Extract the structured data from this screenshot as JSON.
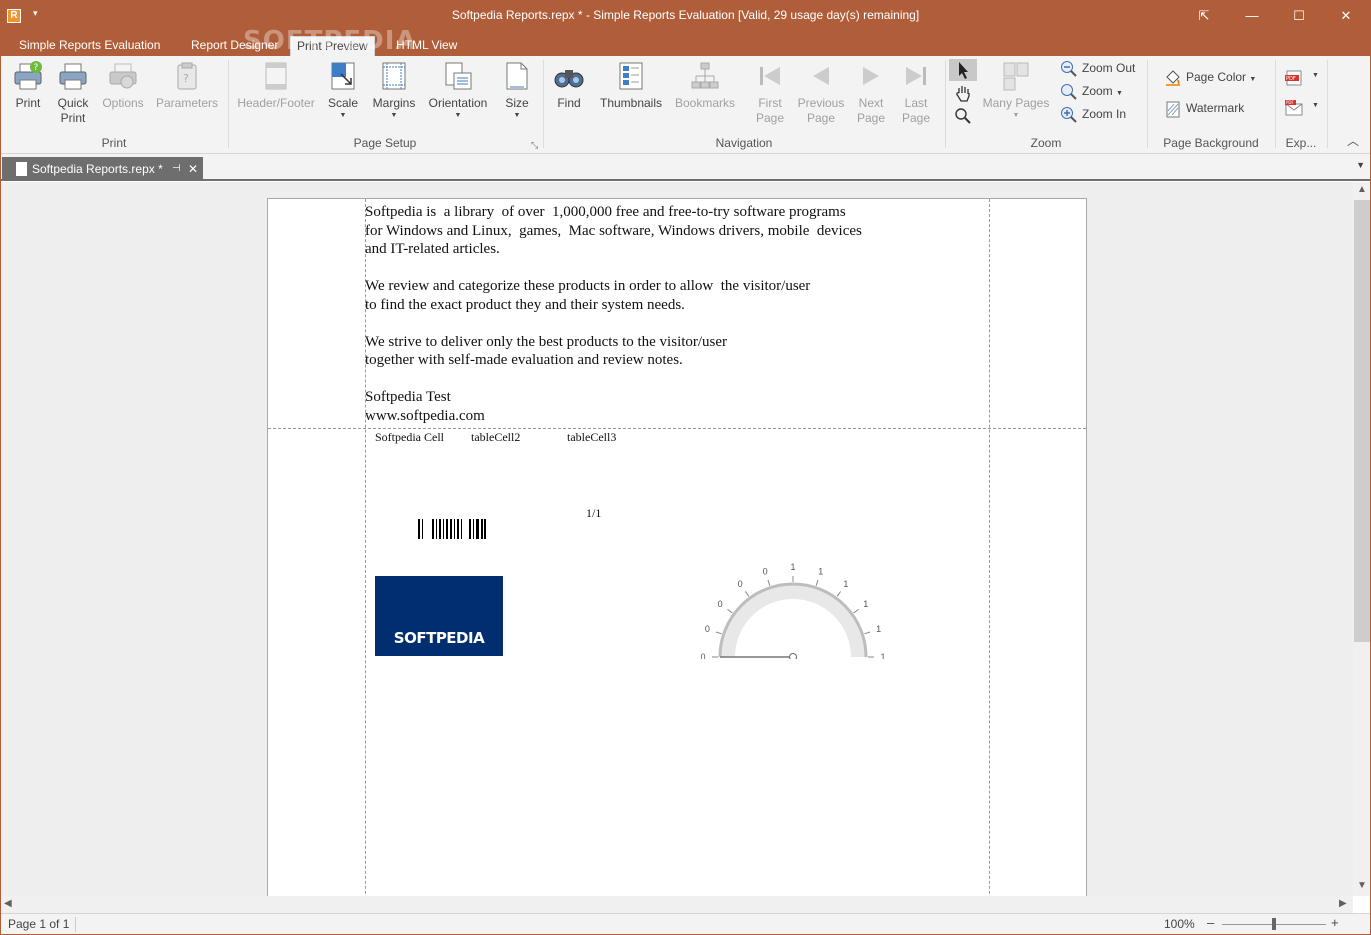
{
  "window": {
    "title": "Softpedia Reports.repx * - Simple Reports Evaluation [Valid,  29 usage day(s) remaining]",
    "app_icon_letter": "R",
    "qat_arrow": "▾",
    "minimize_glyph": "—",
    "restore_glyph": "☐",
    "close_glyph": "✕",
    "ribbon_display_glyph": "⇱"
  },
  "menu_tabs": [
    {
      "label": "Simple Reports Evaluation"
    },
    {
      "label": "Report Designer"
    },
    {
      "label": "Print Preview"
    },
    {
      "label": "HTML View"
    }
  ],
  "watermark_logo": "SOFTPEDIA",
  "ribbon": {
    "print_group": {
      "label": "Print",
      "print": "Print",
      "quick_print_1": "Quick",
      "quick_print_2": "Print",
      "options": "Options",
      "parameters": "Parameters"
    },
    "page_setup_group": {
      "label": "Page Setup",
      "header_footer": "Header/Footer",
      "scale": "Scale",
      "margins": "Margins",
      "orientation": "Orientation",
      "size": "Size",
      "dd_glyph": "▼",
      "launcher": "⤡"
    },
    "navigation_group": {
      "label": "Navigation",
      "find": "Find",
      "thumbnails": "Thumbnails",
      "bookmarks": "Bookmarks",
      "first_1": "First",
      "first_2": "Page",
      "prev_1": "Previous",
      "prev_2": "Page",
      "next_1": "Next",
      "next_2": "Page",
      "last_1": "Last",
      "last_2": "Page"
    },
    "zoom_group": {
      "label": "Zoom",
      "many_pages": "Many Pages",
      "zoom_out": "Zoom Out",
      "zoom": "Zoom",
      "zoom_in": "Zoom In"
    },
    "page_background_group": {
      "label": "Page Background",
      "page_color": "Page Color",
      "watermark": "Watermark"
    },
    "export_group": {
      "label": "Exp..."
    },
    "collapse_glyph": "︿"
  },
  "doc_tab": {
    "title": "Softpedia Reports.repx *",
    "pin_glyph": "⊣",
    "close_glyph": "✕",
    "dropdown_glyph": "▼"
  },
  "report": {
    "paragraph_text": "Softpedia is  a library  of over  1,000,000 free and free-to-try software programs\nfor Windows and Linux,  games,  Mac software, Windows drivers, mobile  devices\nand IT-related articles.\n\nWe review and categorize these products in order to allow  the visitor/user\nto find the exact product they and their system needs.\n\nWe strive to deliver only the best products to the visitor/user\ntogether with self-made evaluation and review notes.\n\nSoftpedia Test\nwww.softpedia.com",
    "cells": [
      "Softpedia Cell",
      "tableCell2",
      "tableCell3"
    ],
    "page_number": "1/1",
    "logo_text": "SOFTPEDIA",
    "gauge_labels": [
      "0",
      "0",
      "0",
      "0",
      "0",
      "1",
      "1",
      "1",
      "1",
      "1",
      "1"
    ],
    "gauge_value": 0
  },
  "status": {
    "page": "Page 1 of 1",
    "zoom": "100%",
    "zoom_minus": "–",
    "zoom_plus": "+",
    "zoom_level": 0.5
  },
  "colors": {
    "accent": "#b05e3a",
    "logo_bg": "#002e6e"
  }
}
